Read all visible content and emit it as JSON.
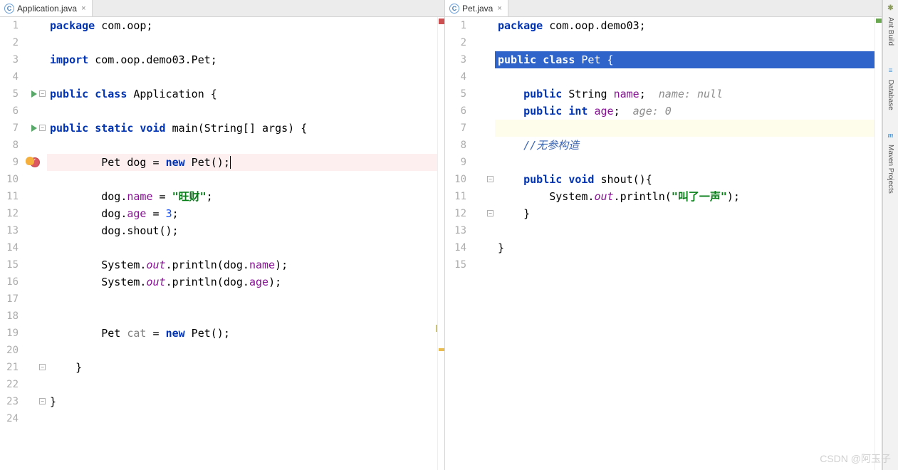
{
  "left": {
    "tab": {
      "name": "Application.java",
      "icon": "C"
    },
    "lines": [
      {
        "n": 1,
        "kind": "plain"
      },
      {
        "n": 2,
        "kind": "empty"
      },
      {
        "n": 3,
        "kind": "plain"
      },
      {
        "n": 4,
        "kind": "empty"
      },
      {
        "n": 5,
        "kind": "plain",
        "run": true,
        "fold": "-"
      },
      {
        "n": 6,
        "kind": "empty"
      },
      {
        "n": 7,
        "kind": "plain",
        "run": true,
        "fold": "-"
      },
      {
        "n": 8,
        "kind": "empty"
      },
      {
        "n": 9,
        "kind": "current",
        "bp": true,
        "bulb": true
      },
      {
        "n": 10,
        "kind": "empty"
      },
      {
        "n": 11,
        "kind": "plain"
      },
      {
        "n": 12,
        "kind": "plain"
      },
      {
        "n": 13,
        "kind": "plain"
      },
      {
        "n": 14,
        "kind": "empty"
      },
      {
        "n": 15,
        "kind": "plain"
      },
      {
        "n": 16,
        "kind": "plain"
      },
      {
        "n": 17,
        "kind": "empty"
      },
      {
        "n": 18,
        "kind": "empty"
      },
      {
        "n": 19,
        "kind": "plain"
      },
      {
        "n": 20,
        "kind": "empty"
      },
      {
        "n": 21,
        "kind": "plain",
        "fold": "-"
      },
      {
        "n": 22,
        "kind": "empty"
      },
      {
        "n": 23,
        "kind": "plain",
        "fold": "-"
      },
      {
        "n": 24,
        "kind": "empty"
      }
    ],
    "code": {
      "l1": {
        "kw1": "package",
        "rest": " com.oop;"
      },
      "l3": {
        "kw1": "import",
        "rest": " com.oop.demo03.Pet;"
      },
      "l5": {
        "kw1": "public class",
        "name": " Application {"
      },
      "l7": {
        "kw1": "public static void",
        "name": " main(String[] args) {"
      },
      "l9": {
        "pre": "        Pet dog = ",
        "kw": "new",
        "post": " Pet();"
      },
      "l11": {
        "pre": "        dog.",
        "fld": "name",
        "mid": " = ",
        "str": "\"旺财\"",
        "post": ";"
      },
      "l12": {
        "pre": "        dog.",
        "fld": "age",
        "mid": " = ",
        "num": "3",
        "post": ";"
      },
      "l13": {
        "text": "        dog.shout();"
      },
      "l15": {
        "pre": "        System.",
        "sf": "out",
        "mid": ".println(dog.",
        "fld": "name",
        "post": ");"
      },
      "l16": {
        "pre": "        System.",
        "sf": "out",
        "mid": ".println(dog.",
        "fld": "age",
        "post": ");"
      },
      "l19": {
        "pre": "        Pet ",
        "unused": "cat",
        "mid": " = ",
        "kw": "new",
        "post": " Pet();"
      },
      "l21": {
        "text": "    }"
      },
      "l23": {
        "text": "}"
      }
    }
  },
  "right": {
    "tab": {
      "name": "Pet.java",
      "icon": "C"
    },
    "lines": [
      {
        "n": 1,
        "kind": "plain"
      },
      {
        "n": 2,
        "kind": "empty"
      },
      {
        "n": 3,
        "kind": "sel"
      },
      {
        "n": 4,
        "kind": "empty"
      },
      {
        "n": 5,
        "kind": "plain"
      },
      {
        "n": 6,
        "kind": "plain"
      },
      {
        "n": 7,
        "kind": "yellow"
      },
      {
        "n": 8,
        "kind": "plain"
      },
      {
        "n": 9,
        "kind": "empty"
      },
      {
        "n": 10,
        "kind": "plain",
        "fold": "-"
      },
      {
        "n": 11,
        "kind": "plain"
      },
      {
        "n": 12,
        "kind": "plain",
        "fold": "-"
      },
      {
        "n": 13,
        "kind": "empty"
      },
      {
        "n": 14,
        "kind": "plain"
      },
      {
        "n": 15,
        "kind": "empty"
      }
    ],
    "code": {
      "l1": {
        "kw1": "package",
        "rest": " com.oop.demo03;"
      },
      "l3": {
        "kw1": "public class ",
        "name": "Pet {"
      },
      "l5": {
        "pre": "    ",
        "kw": "public",
        "type": " String ",
        "fld": "name",
        "post": ";",
        "hint": "  name: null"
      },
      "l6": {
        "pre": "    ",
        "kw": "public int",
        "mid": " ",
        "fld": "age",
        "post": ";",
        "hint": "  age: 0"
      },
      "l8": {
        "pre": "    ",
        "comment": "//无参构造"
      },
      "l10": {
        "pre": "    ",
        "kw": "public void",
        "post": " shout(){"
      },
      "l11": {
        "pre": "        System.",
        "sf": "out",
        "mid": ".println(",
        "str": "\"叫了一声\"",
        "post": ");"
      },
      "l12": {
        "text": "    }"
      },
      "l14": {
        "text": "}"
      }
    }
  },
  "sidebar": {
    "items": [
      {
        "label": "Ant Build",
        "icon": "🐜",
        "cls": "ant"
      },
      {
        "label": "Database",
        "icon": "☰",
        "cls": "db"
      },
      {
        "label": "Maven Projects",
        "icon": "m",
        "cls": "maven"
      }
    ]
  },
  "watermark": "CSDN @阿玉子"
}
